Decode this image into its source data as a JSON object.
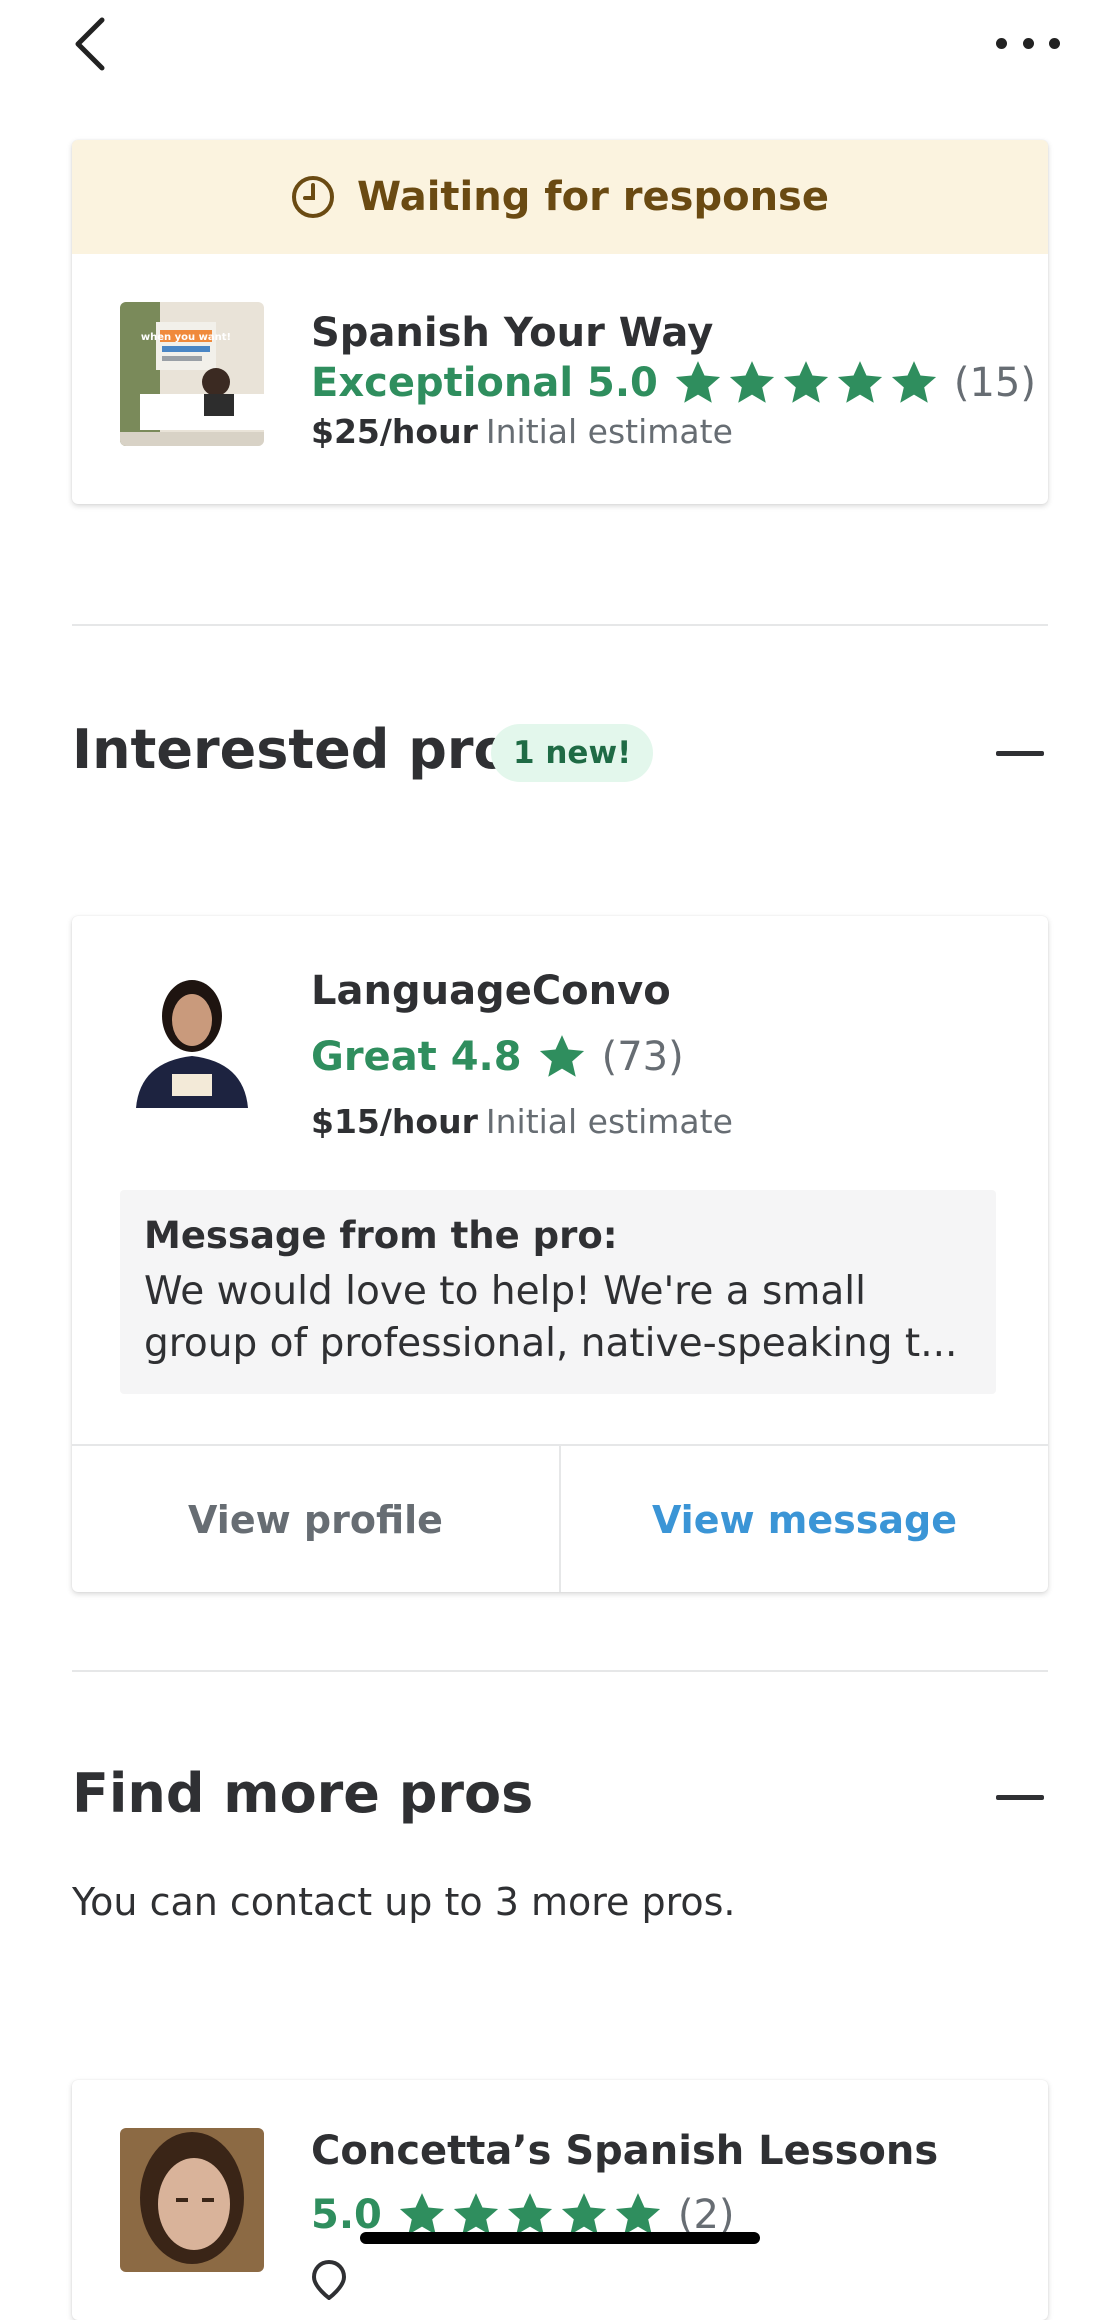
{
  "topbar": {
    "back_icon": "chevron-left-icon",
    "more_icon": "more-horizontal-icon"
  },
  "waiting_card": {
    "status_text": "Waiting for response",
    "status_icon": "clock-icon",
    "pro": {
      "name": "Spanish Your Way",
      "rating_label": "Exceptional 5.0",
      "stars": 5,
      "reviews": "(15)",
      "price": "$25/hour",
      "price_note": "Initial estimate",
      "thumb_text": "when you want!"
    }
  },
  "interested": {
    "title": "Interested pros",
    "badge": "1 new!",
    "pro": {
      "name": "LanguageConvo",
      "rating_label": "Great 4.8",
      "stars": 1,
      "reviews": "(73)",
      "price": "$15/hour",
      "price_note": "Initial estimate",
      "message_title": "Message from the pro:",
      "message_body": "We would love to help! We're a small group of professional, native-speaking t..."
    },
    "actions": {
      "view_profile": "View profile",
      "view_message": "View message"
    }
  },
  "find_more": {
    "title": "Find more pros",
    "subtitle": "You can contact up to 3 more pros.",
    "pro": {
      "name": "Concetta’s Spanish Lessons",
      "rating_label": "5.0",
      "stars": 5,
      "reviews": "(2)"
    }
  },
  "colors": {
    "accent_green": "#2f8e5e",
    "link_blue": "#3b95d6",
    "waiting_bg": "#fbf3df",
    "waiting_text": "#6a4a12"
  }
}
